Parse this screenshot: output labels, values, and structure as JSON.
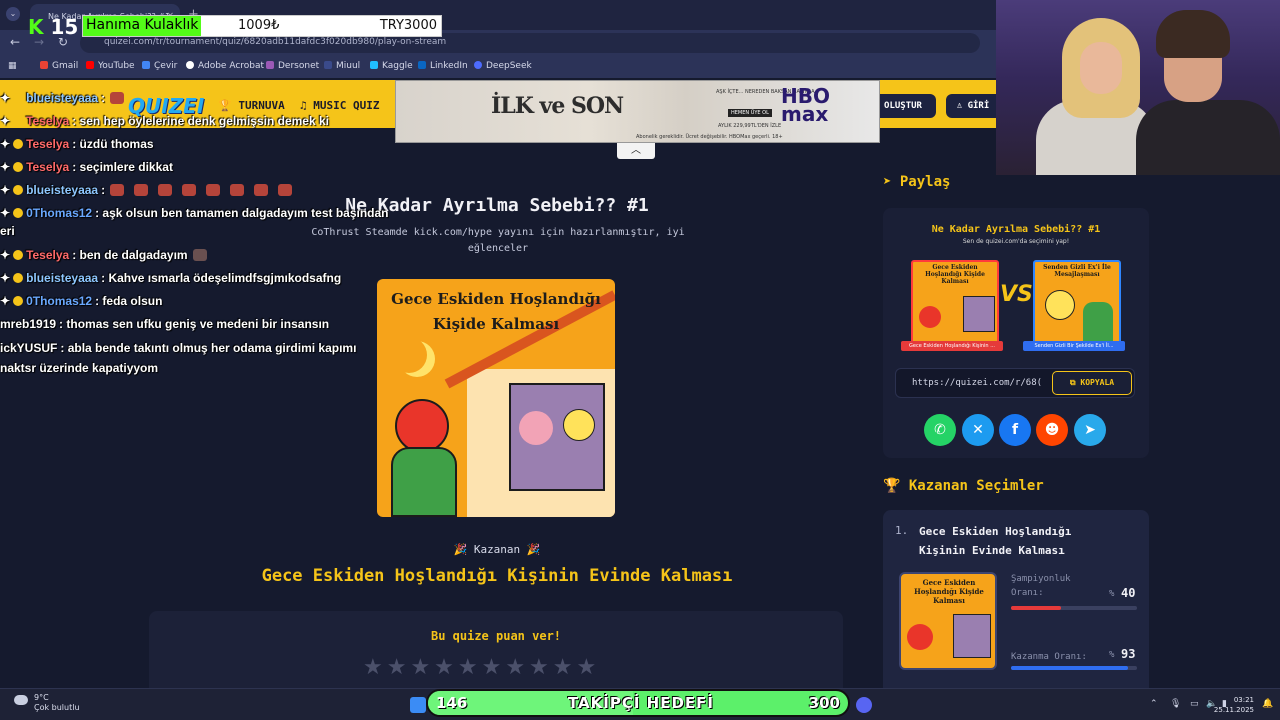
{
  "browser": {
    "tab_title": "Ne Kadar Ayrılma Sebebi?? #1",
    "tab_close": "×",
    "new_tab": "+",
    "url": "quizei.com/tr/tournament/quiz/6820adb11dafdc3f020db980/play-on-stream",
    "bookmarks": [
      "Gmail",
      "YouTube",
      "Çevir",
      "Adobe Acrobat",
      "Dersonet",
      "Miuul",
      "Kaggle",
      "LinkedIn",
      "DeepSeek"
    ]
  },
  "overlay": {
    "kick_count": "15",
    "donor": "Hanıma Kulaklık",
    "amount": "1009₺",
    "goal": "TRY3000"
  },
  "site": {
    "logo": "QUIZEI",
    "nav": [
      "TURNUVA",
      "MUSIC QUIZ"
    ],
    "create": "OLUŞTUR",
    "login": "GİRİ"
  },
  "ad": {
    "title": "İLK ve SON",
    "brand": "HBO max",
    "line1": "AŞK İÇTE... NEREDEN BAKSAN BAŞINLA",
    "line2": "HEMEN ÜYE OL",
    "line3": "AYLIK 229,99TL'DEN İZLE",
    "footer": "Abonelik gereklidir. Ücret değişebilir. HBOMax geçerli. 18+"
  },
  "main": {
    "title": "Ne Kadar Ayrılma Sebebi?? #1",
    "description": "CoThrust Steamde kick.com/hype yayını için hazırlanmıştır, iyi eğlenceler",
    "card_text": "Gece Eskiden Hoşlandığı Kişide Kalması",
    "winner_label": "🎉  Kazanan  🎉",
    "winner_name": "Gece Eskiden Hoşlandığı Kişinin Evinde Kalması",
    "rate_title": "Bu quize puan ver!",
    "stars": "★★★★★★★★★★"
  },
  "sidebar": {
    "share_title": "Paylaş",
    "share_image_title": "Ne Kadar Ayrılma Sebebi?? #1",
    "share_image_sub": "Sen de quizei.com'da seçimini yap!",
    "left_caption": "Gece Eskiden Hoşlandığı Kişinin ...",
    "right_caption": "Senden Gizli Bir Şekilde Ex'i İl...",
    "left_mini_text": "Gece Eskiden Hoşlandığı Kişide Kalması",
    "right_mini_text": "Senden Gizli Ex'i İle Mesajlaşması",
    "vs": "VS",
    "share_url": "https://quizei.com/r/68(",
    "copy": "KOPYALA",
    "winners_title": "Kazanan Seçimler",
    "winners": [
      {
        "rank": "1.",
        "name": "Gece Eskiden Hoşlandığı Kişinin Evinde Kalması",
        "champ_label": "Şampiyonluk Oranı:",
        "champ_pct": "%",
        "champ_val": "40",
        "win_label": "Kazanma Oranı:",
        "win_pct": "%",
        "win_val": "93"
      }
    ]
  },
  "chat": [
    {
      "user": "blueisteyaaa",
      "msg": ":",
      "color": "#8ec7ff"
    },
    {
      "user": "Teselya",
      "msg": ": sen hep öylelerine denk gelmişsin demek ki",
      "color": "#ff6a6a"
    },
    {
      "user": "Teselya",
      "msg": ": üzdü thomas",
      "color": "#ff6a6a"
    },
    {
      "user": "Teselya",
      "msg": ": seçimlere dikkat",
      "color": "#ff6a6a"
    },
    {
      "user": "blueisteyaaa",
      "msg": ":",
      "color": "#8ec7ff"
    },
    {
      "user": "0Thomas12",
      "msg": ": aşk olsun ben tamamen dalgadayım test başından",
      "color": "#6aa8ff"
    },
    {
      "user": "",
      "msg": "eri",
      "color": "#ffffff"
    },
    {
      "user": "Teselya",
      "msg": ": ben de dalgadayım",
      "color": "#ff6a6a"
    },
    {
      "user": "blueisteyaaa",
      "msg": ": Kahve ısmarla ödeşelimdfsgjmıkodsafng",
      "color": "#8ec7ff"
    },
    {
      "user": "0Thomas12",
      "msg": ": feda olsun",
      "color": "#6aa8ff"
    },
    {
      "user": "mreb1919",
      "msg": ": thomas sen ufku geniş ve medeni bir insansın",
      "color": "#ffffff"
    },
    {
      "user": "ickYUSUF",
      "msg": ": abla bende takıntı olmuş her odama girdimi kapımı",
      "color": "#ffffff"
    },
    {
      "user": "",
      "msg": "naktsr üzerinde kapatiyyom",
      "color": "#ffffff"
    }
  ],
  "goal_bar": {
    "current": "146",
    "label": "TAKİPÇİ HEDEFİ",
    "target": "300",
    "progress": 0.487
  },
  "taskbar": {
    "temp": "9°C",
    "weather": "Çok bulutlu",
    "time": "03:21",
    "date": "25.11.2025"
  },
  "colors": {
    "accent_yellow": "#f5c419",
    "page_bg": "#151a2e",
    "kick_green": "#53fc18",
    "champ_bar": "#e53a3a",
    "win_bar": "#2f6df0"
  }
}
